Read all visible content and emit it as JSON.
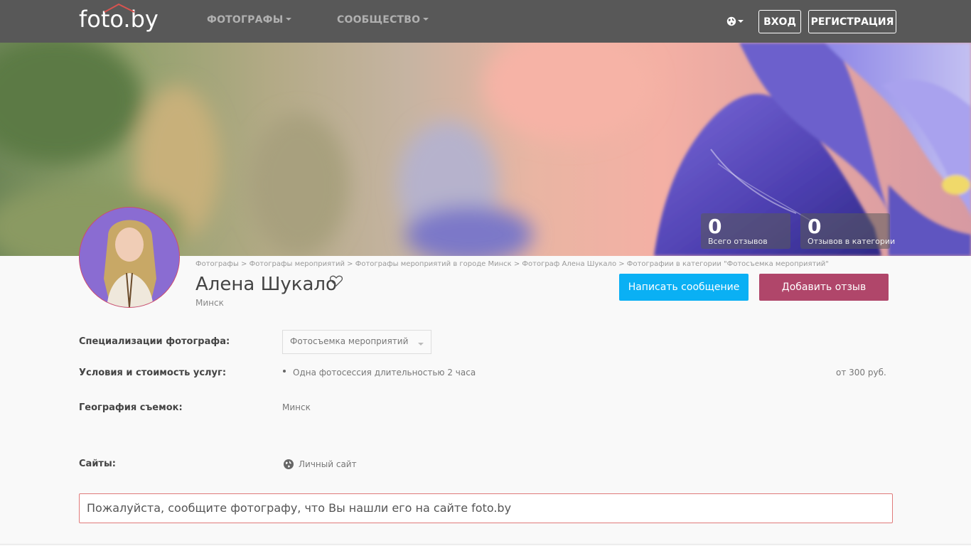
{
  "nav": {
    "logo": "foto.by",
    "photographers": "ФОТОГРАФЫ",
    "community": "СООБЩЕСТВО",
    "login": "ВХОД",
    "register": "РЕГИСТРАЦИЯ"
  },
  "stats": [
    {
      "value": "0",
      "label": "Всего отзывов"
    },
    {
      "value": "0",
      "label": "Отзывов в категории"
    }
  ],
  "breadcrumb": "Фотографы > Фотографы мероприятий > Фотографы мероприятий в городе Минск > Фотограф Алена Шукало > Фотографии в категории \"Фотосъемка мероприятий\"",
  "profile": {
    "name": "Алена Шукало",
    "city": "Минск",
    "write_message": "Написать сообщение",
    "add_review": "Добавить отзыв"
  },
  "details": {
    "specializations_label": "Специализации фотографа:",
    "specialization_selected": "Фотосъемка мероприятий",
    "services_label": "Условия и стоимость услуг:",
    "service_item": "Одна фотосессия длительностью 2 часа",
    "service_price": "от 300 руб.",
    "geo_label": "География съемок:",
    "geo_value": "Минск",
    "sites_label": "Сайты:",
    "site_link": "Личный сайт"
  },
  "notice": "Пожалуйста, сообщите фотографу, что Вы нашли его на сайте foto.by",
  "colors": {
    "nav_bg": "#585858",
    "message_btn": "#0ab0f4",
    "review_btn": "#b0466a",
    "notice_border": "#e07a7a"
  }
}
